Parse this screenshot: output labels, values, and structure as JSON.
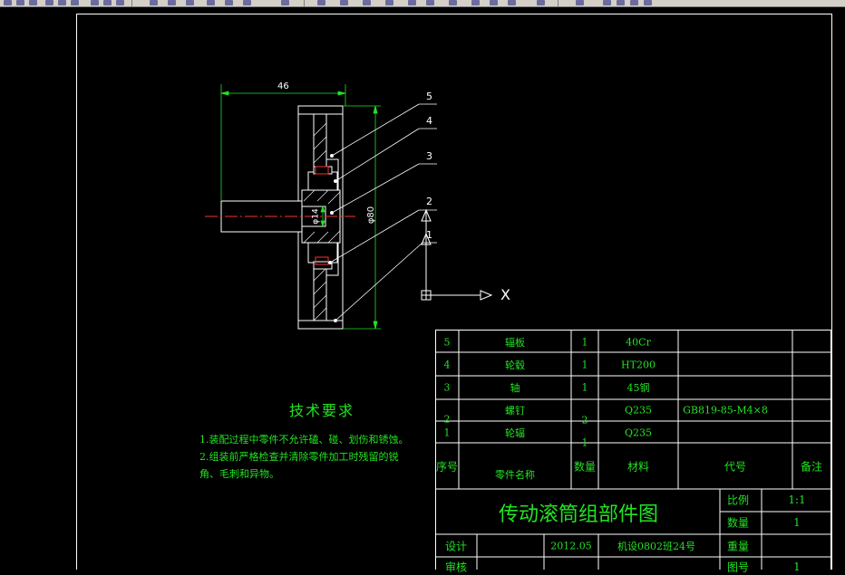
{
  "drawing": {
    "dimension_width": "46",
    "dimension_dia_outer": "φ80",
    "dimension_dia_inner": "φ14",
    "balloons": [
      "5",
      "4",
      "3",
      "2",
      "1"
    ],
    "ucs_axis_x": "X"
  },
  "tech_requirements": {
    "title": "技术要求",
    "lines": [
      "1.装配过程中零件不允许磕、碰、划伤和锈蚀。",
      "2.组装前严格检查并清除零件加工时残留的锐",
      "角、毛刺和异物。"
    ]
  },
  "parts_table": {
    "rows": [
      {
        "no": "5",
        "name": "辐板",
        "qty": "1",
        "material": "40Cr",
        "code": "",
        "note": ""
      },
      {
        "no": "4",
        "name": "轮毂",
        "qty": "1",
        "material": "HT200",
        "code": "",
        "note": ""
      },
      {
        "no": "3",
        "name": "轴",
        "qty": "1",
        "material": "45钢",
        "code": "",
        "note": ""
      },
      {
        "no": "2",
        "name": "螺钉",
        "qty": "2",
        "material": "Q235",
        "code": "GB819-85-M4×8",
        "note": ""
      },
      {
        "no": "1",
        "name": "轮辐",
        "qty": "1",
        "material": "Q235",
        "code": "",
        "note": ""
      }
    ],
    "header": {
      "no": "序号",
      "name": "零件名称",
      "qty": "数量",
      "material": "材料",
      "code": "代号",
      "note": "备注"
    }
  },
  "title_block": {
    "drawing_title": "传动滚筒组部件图",
    "scale_label": "比例",
    "scale_value": "1:1",
    "qty_label": "数量",
    "qty_value": "1",
    "designer_label": "设计",
    "date": "2012.05",
    "class": "机设0802班24号",
    "weight_label": "重量",
    "review_label": "审核",
    "drawing_no_label": "图号",
    "drawing_no_value": "1"
  },
  "colors": {
    "background": "#000000",
    "lines": "#ffffff",
    "text": "#22e322",
    "centerline": "#ff3030",
    "dimension": "#22e322"
  }
}
